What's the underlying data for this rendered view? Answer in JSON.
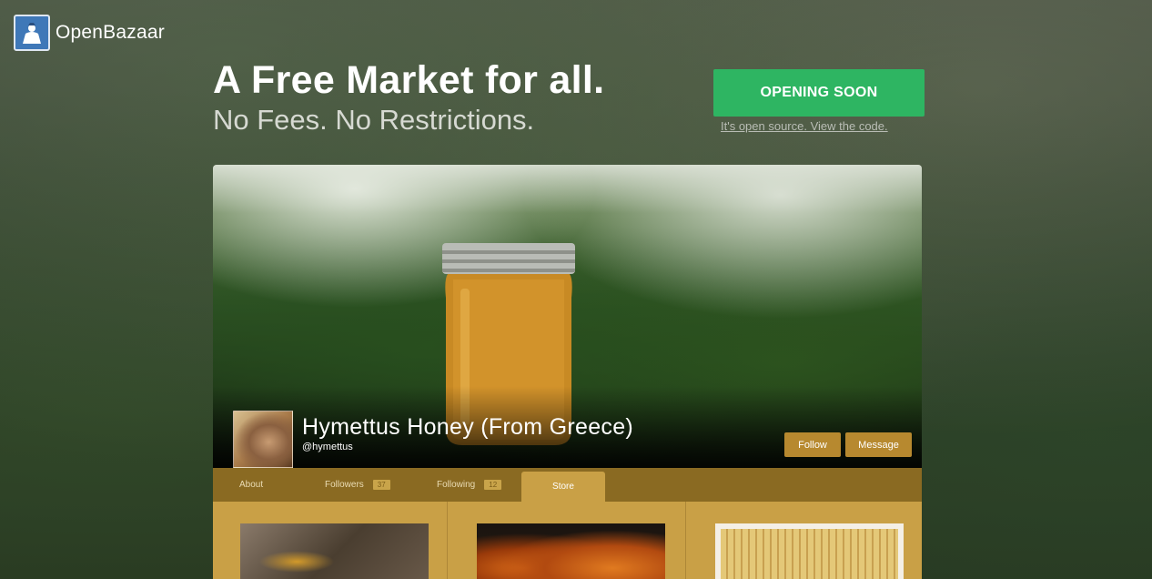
{
  "brand": {
    "name": "OpenBazaar",
    "icon": "openbazaar-logo-icon"
  },
  "hero": {
    "headline": "A Free Market for all.",
    "subline": "No Fees. No Restrictions.",
    "cta_label": "OPENING SOON",
    "source_link": "It's open source. View the code."
  },
  "store": {
    "name": "Hymettus Honey (From Greece)",
    "handle": "@hymettus",
    "follow_label": "Follow",
    "message_label": "Message",
    "tabs": [
      {
        "label": "About"
      },
      {
        "label": "Followers",
        "count": "37"
      },
      {
        "label": "Following",
        "count": "12"
      },
      {
        "label": "Store",
        "active": true
      }
    ]
  },
  "colors": {
    "accent_green": "#2eb562",
    "gold": "#b7892f",
    "tab_bar": "#8a6a22",
    "store_bg": "#c9a046"
  }
}
